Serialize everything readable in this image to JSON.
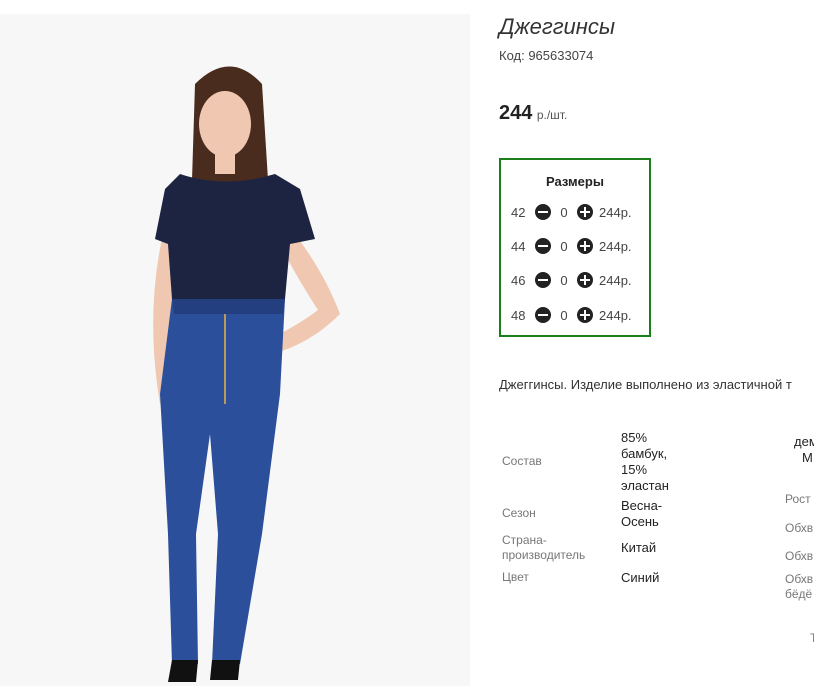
{
  "product": {
    "title": "Джеггинсы",
    "code": "Код: 965633074",
    "price": "244",
    "price_unit": "р./шт."
  },
  "sizes": {
    "heading": "Размеры",
    "rows": [
      {
        "size": "42",
        "qty": "0",
        "price": "244р."
      },
      {
        "size": "44",
        "qty": "0",
        "price": "244р."
      },
      {
        "size": "46",
        "qty": "0",
        "price": "244р."
      },
      {
        "size": "48",
        "qty": "0",
        "price": "244р."
      }
    ]
  },
  "description": "Джеггинсы. Изделие выполнено из эластичной т",
  "specs": [
    {
      "label": "Состав",
      "value": "85% бамбук, 15% эластан"
    },
    {
      "label": "Сезон",
      "value": "Весна-Осень"
    },
    {
      "label": "Страна-производитель",
      "value": "Китай"
    },
    {
      "label": "Цвет",
      "value": "Синий"
    }
  ],
  "specs_right_clipped": [
    "дем",
    "М",
    "Рост",
    "Обхв",
    "Обхв",
    "Обхв",
    "бёдё",
    "Т"
  ],
  "colors": {
    "accent_border": "#1a7f1a",
    "button": "#222222"
  }
}
